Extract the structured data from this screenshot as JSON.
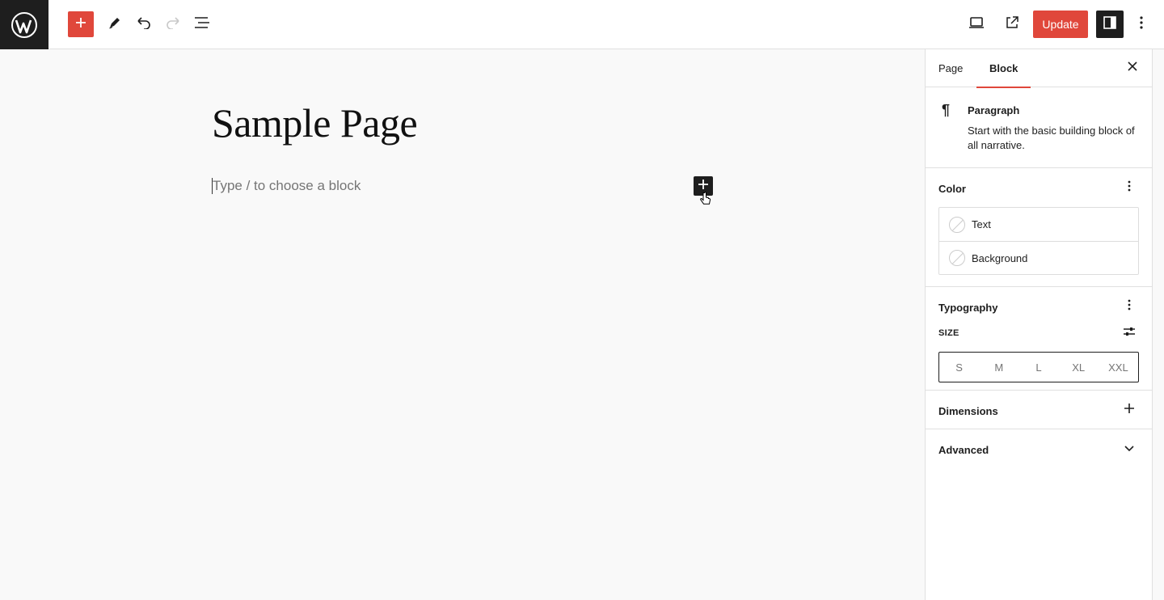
{
  "topbar": {
    "update_label": "Update"
  },
  "editor": {
    "page_title": "Sample Page",
    "block_placeholder": "Type / to choose a block"
  },
  "sidebar": {
    "tabs": [
      {
        "label": "Page"
      },
      {
        "label": "Block"
      }
    ],
    "block_card": {
      "title": "Paragraph",
      "description": "Start with the basic building block of all narrative."
    },
    "color": {
      "title": "Color",
      "items": [
        {
          "label": "Text"
        },
        {
          "label": "Background"
        }
      ]
    },
    "typography": {
      "title": "Typography",
      "size_label": "SIZE",
      "sizes": [
        "S",
        "M",
        "L",
        "XL",
        "XXL"
      ]
    },
    "dimensions": {
      "title": "Dimensions"
    },
    "advanced": {
      "title": "Advanced"
    }
  },
  "colors": {
    "accent": "#e0473b",
    "dark": "#1e1e1e"
  }
}
